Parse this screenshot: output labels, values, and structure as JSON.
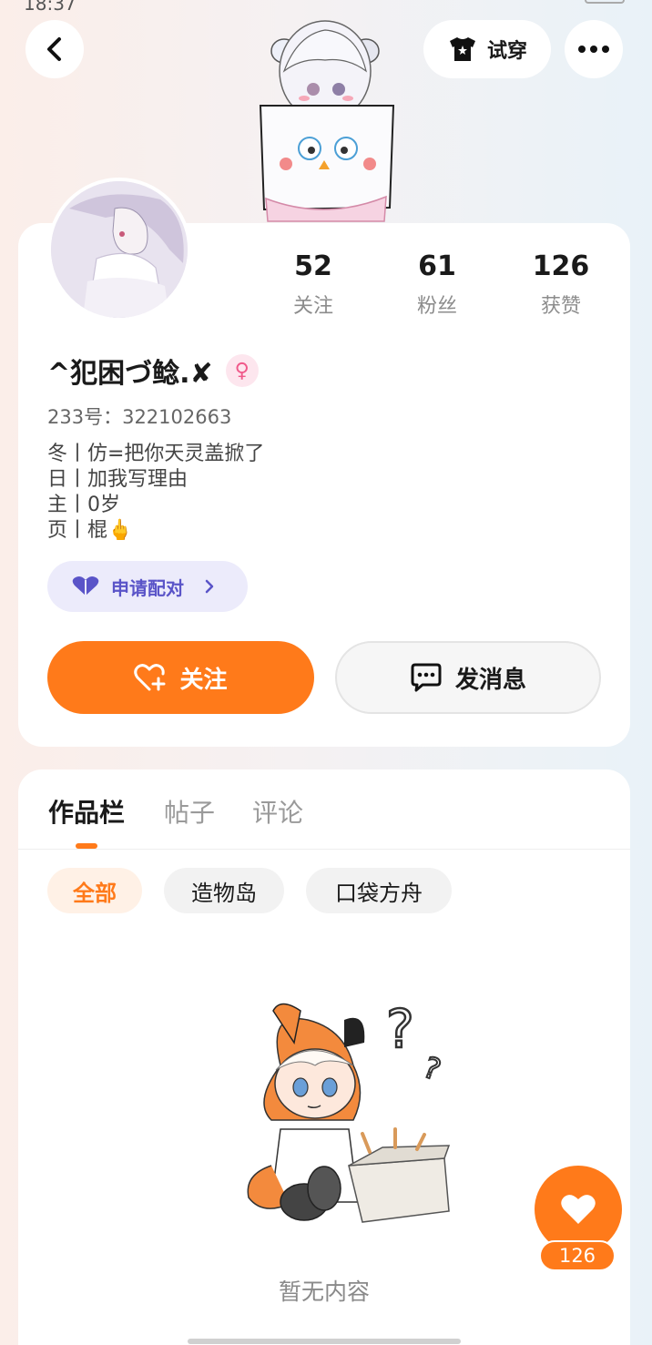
{
  "status_bar": {
    "time": "18:37"
  },
  "header": {
    "back_icon": "chevron-left-icon",
    "try_on_label": "试穿",
    "try_on_icon": "shirt-icon",
    "more_icon": "more-horizontal-icon"
  },
  "profile": {
    "stats": [
      {
        "value": "52",
        "label": "关注"
      },
      {
        "value": "61",
        "label": "粉丝"
      },
      {
        "value": "126",
        "label": "获赞"
      }
    ],
    "username": "^犯困づ鲶.✘",
    "gender_icon": "female-icon",
    "uid_label": "233号：322102663",
    "bio_lines": [
      "冬丨仿=把你天灵盖掀了",
      "日丨加我写理由",
      "主丨0岁",
      "页丨棍🖕"
    ],
    "pair_button_label": "申请配对",
    "follow_button_label": "关注",
    "message_button_label": "发消息"
  },
  "works": {
    "tabs": [
      "作品栏",
      "帖子",
      "评论"
    ],
    "active_tab": "作品栏",
    "filters": [
      "全部",
      "造物岛",
      "口袋方舟"
    ],
    "active_filter": "全部",
    "empty_text": "暂无内容"
  },
  "like_fab": {
    "count": "126"
  },
  "colors": {
    "accent": "#ff7a1a",
    "pair": "#5a54c8",
    "female": "#f0598a"
  }
}
